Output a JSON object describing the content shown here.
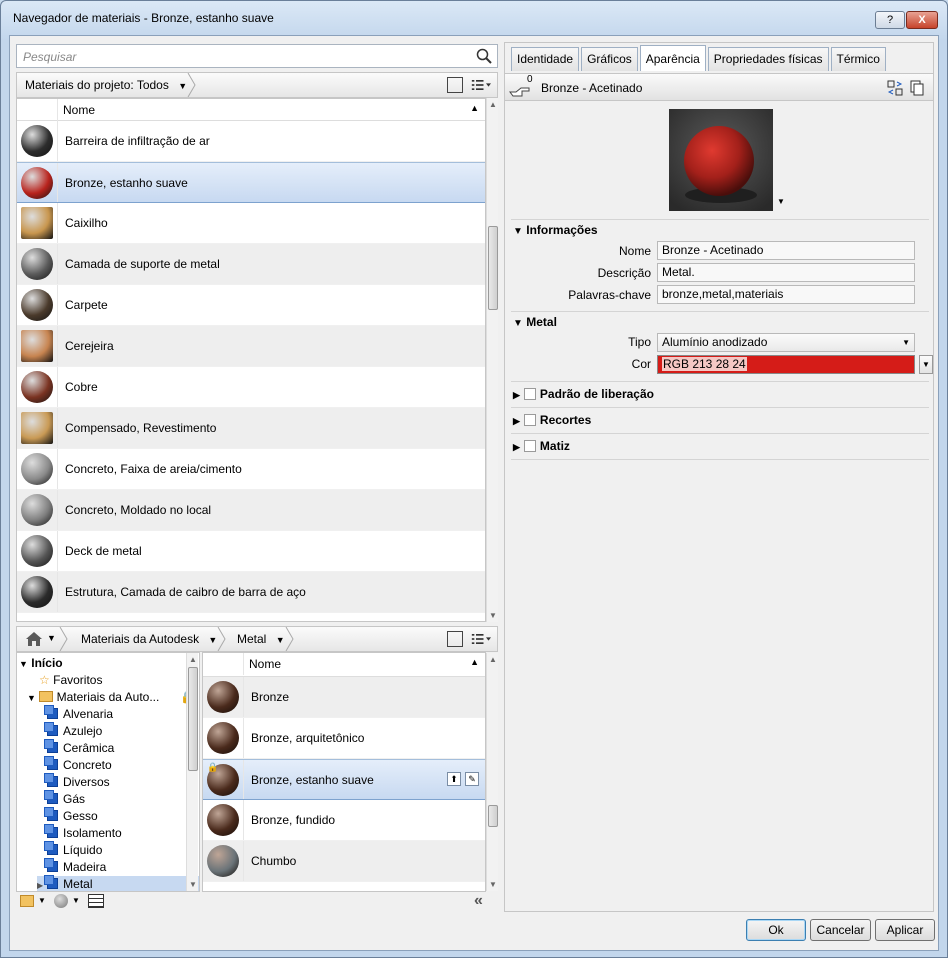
{
  "window": {
    "title": "Navegador de materiais - Bronze, estanho suave",
    "help": "?",
    "close": "X"
  },
  "search": {
    "placeholder": "Pesquisar"
  },
  "project_bar": {
    "label": "Materiais do projeto: Todos"
  },
  "project_list": {
    "header": "Nome",
    "items": [
      {
        "label": "Barreira de infiltração de ar",
        "swatch": "#2d2d2d"
      },
      {
        "label": "Bronze, estanho suave",
        "swatch": "#b8231d",
        "selected": true
      },
      {
        "label": "Caixilho",
        "swatch": "#c8964e"
      },
      {
        "label": "Camada de suporte de metal",
        "swatch": "#5a5a5a"
      },
      {
        "label": "Carpete",
        "swatch": "#4a3a2b"
      },
      {
        "label": "Cerejeira",
        "swatch": "#c78450"
      },
      {
        "label": "Cobre",
        "swatch": "#7a3322"
      },
      {
        "label": "Compensado, Revestimento",
        "swatch": "#c99a55"
      },
      {
        "label": "Concreto, Faixa de areia/cimento",
        "swatch": "#8a8a8a"
      },
      {
        "label": "Concreto, Moldado no local",
        "swatch": "#7f7f7f"
      },
      {
        "label": "Deck de metal",
        "swatch": "#555555"
      },
      {
        "label": "Estrutura, Camada de caibro de barra de aço",
        "swatch": "#2b2b2b"
      }
    ]
  },
  "library_bar": {
    "crumb1": "Materiais da Autodesk",
    "crumb2": "Metal"
  },
  "tree": {
    "root": "Início",
    "favorites": "Favoritos",
    "library": "Materiais da Auto...",
    "categories": [
      "Alvenaria",
      "Azulejo",
      "Cerâmica",
      "Concreto",
      "Diversos",
      "Gás",
      "Gesso",
      "Isolamento",
      "Líquido",
      "Madeira",
      "Metal"
    ]
  },
  "library_list": {
    "header": "Nome",
    "items": [
      {
        "label": "Bronze",
        "swatch": "#4a2a1c"
      },
      {
        "label": "Bronze, arquitetônico",
        "swatch": "#4a2a1c"
      },
      {
        "label": "Bronze, estanho suave",
        "swatch": "#4a2a1c",
        "selected": true
      },
      {
        "label": "Bronze, fundido",
        "swatch": "#4a2a1c"
      },
      {
        "label": "Chumbo",
        "swatch": "#6a7378"
      }
    ]
  },
  "tabs": [
    "Identidade",
    "Gráficos",
    "Aparência",
    "Propriedades físicas",
    "Térmico"
  ],
  "asset": {
    "name": "Bronze - Acetinado",
    "count": "0"
  },
  "info": {
    "section": "Informações",
    "name_label": "Nome",
    "name_value": "Bronze - Acetinado",
    "desc_label": "Descrição",
    "desc_value": "Metal.",
    "kw_label": "Palavras-chave",
    "kw_value": "bronze,metal,materiais"
  },
  "metal": {
    "section": "Metal",
    "type_label": "Tipo",
    "type_value": "Alumínio anodizado",
    "color_label": "Cor",
    "color_value": "RGB 213 28 24",
    "color_hex": "#d51c18"
  },
  "collapsed_sections": [
    "Padrão de liberação",
    "Recortes",
    "Matiz"
  ],
  "footer": {
    "ok": "Ok",
    "cancel": "Cancelar",
    "apply": "Aplicar"
  }
}
